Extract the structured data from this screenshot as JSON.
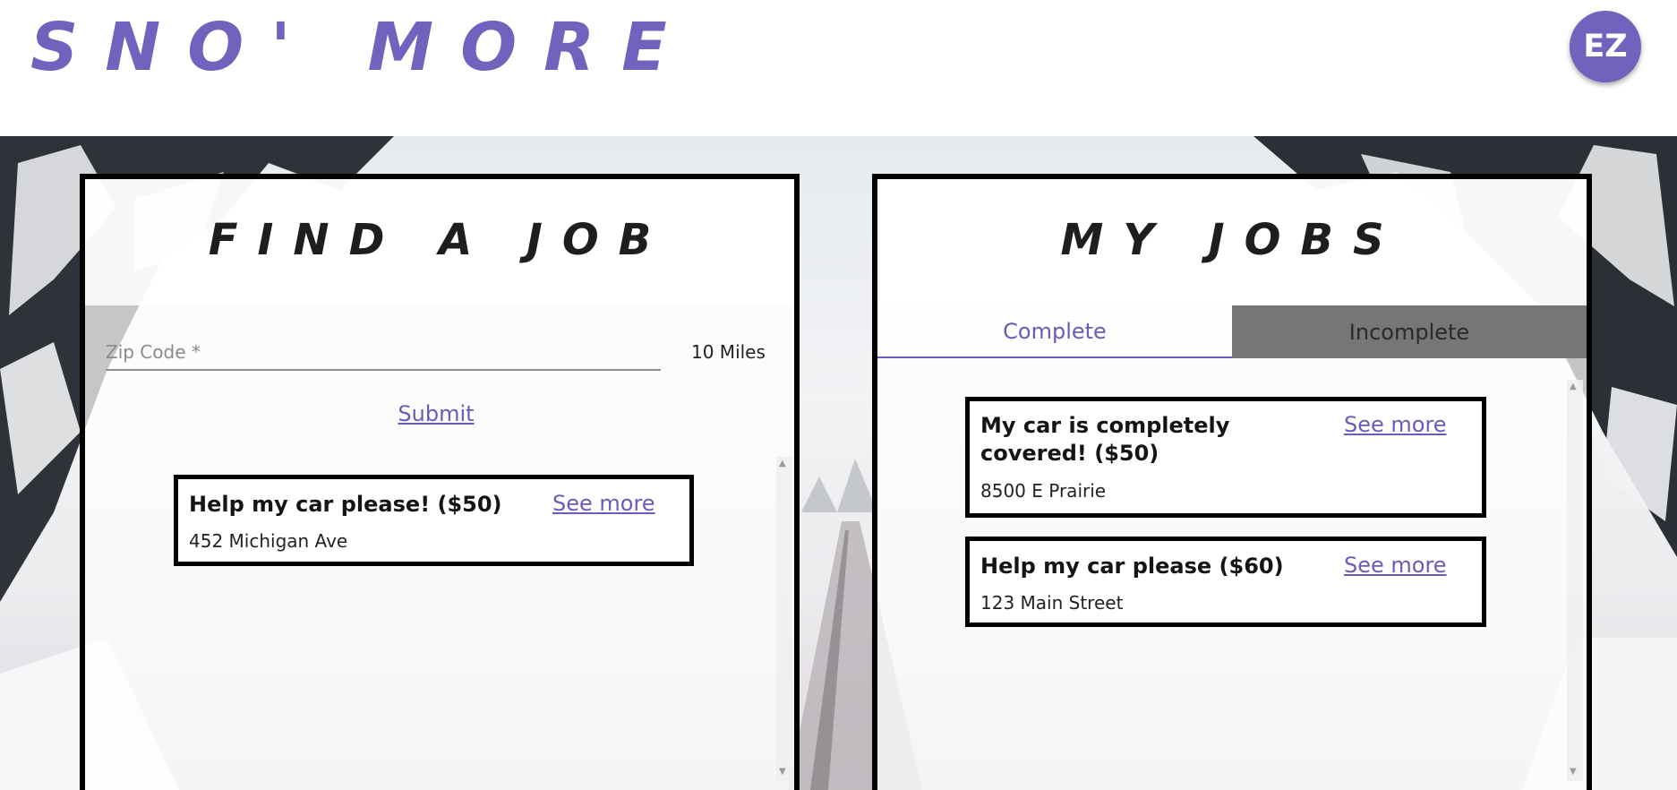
{
  "header": {
    "logo": "SNO' MORE",
    "avatar_initials": "EZ"
  },
  "colors": {
    "accent": "#7361be",
    "link": "#6b5bb8",
    "card_border": "#000000",
    "inactive_tab": "#767676"
  },
  "find_job": {
    "title": "FIND A JOB",
    "zip_placeholder": "Zip Code *",
    "zip_value": "",
    "radius": "10 Miles",
    "submit_label": "Submit",
    "results": [
      {
        "title": "Help my car please! ($50)",
        "address": "452 Michigan Ave",
        "link": "See more"
      }
    ]
  },
  "my_jobs": {
    "title": "MY JOBS",
    "tabs": [
      {
        "label": "Complete",
        "active": true
      },
      {
        "label": "Incomplete",
        "active": false
      }
    ],
    "jobs": [
      {
        "title_line1": "My car is completely",
        "title_line2": "covered! ($50)",
        "address": "8500 E Prairie",
        "link": "See more"
      },
      {
        "title": "Help my car please ($60)",
        "address": "123 Main Street",
        "link": "See more"
      }
    ]
  },
  "icons": {
    "scroll_up": "triangle-up-icon",
    "scroll_down": "triangle-down-icon"
  }
}
